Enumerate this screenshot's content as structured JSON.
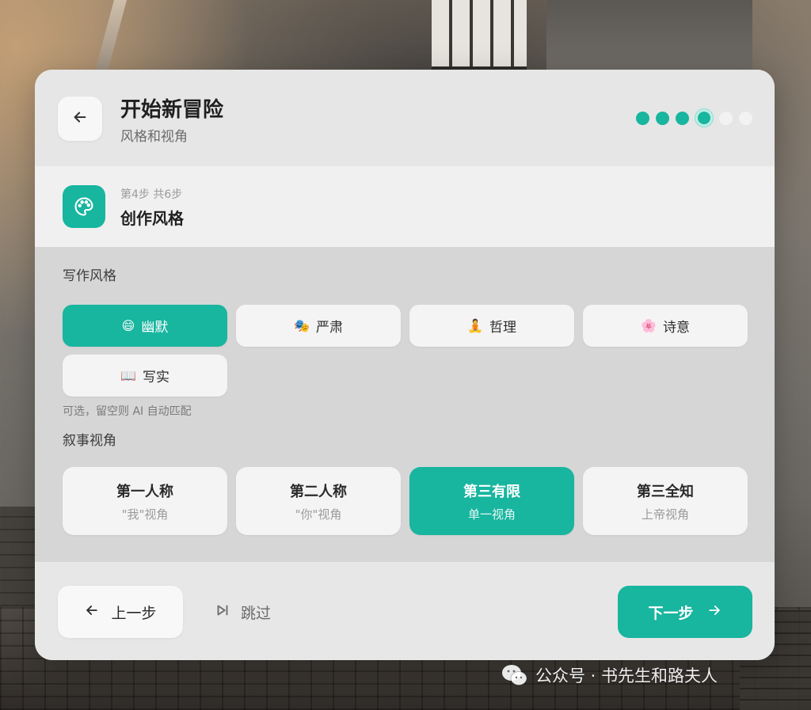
{
  "colors": {
    "accent": "#18b59f",
    "chip_bg": "#f4f4f4",
    "body_bg": "#d6d6d6"
  },
  "header": {
    "back_icon": "arrow-left-icon",
    "title": "开始新冒险",
    "subtitle": "风格和视角",
    "progress": {
      "total": 6,
      "current": 4
    }
  },
  "step": {
    "icon": "palette-icon",
    "count": "第4步 共6步",
    "name": "创作风格"
  },
  "writing_style": {
    "label": "写作风格",
    "options": [
      {
        "emoji": "😄",
        "label": "幽默",
        "selected": true
      },
      {
        "emoji": "🎭",
        "label": "严肃",
        "selected": false
      },
      {
        "emoji": "🧘",
        "label": "哲理",
        "selected": false
      },
      {
        "emoji": "🌸",
        "label": "诗意",
        "selected": false
      },
      {
        "emoji": "📖",
        "label": "写实",
        "selected": false
      }
    ],
    "hint": "可选，留空则 AI 自动匹配"
  },
  "perspective": {
    "label": "叙事视角",
    "options": [
      {
        "title": "第一人称",
        "desc": "\"我\"视角",
        "selected": false
      },
      {
        "title": "第二人称",
        "desc": "\"你\"视角",
        "selected": false
      },
      {
        "title": "第三有限",
        "desc": "单一视角",
        "selected": true
      },
      {
        "title": "第三全知",
        "desc": "上帝视角",
        "selected": false
      }
    ]
  },
  "footer": {
    "prev_label": "上一步",
    "skip_label": "跳过",
    "next_label": "下一步"
  },
  "watermark": {
    "text": "公众号 · 书先生和路夫人",
    "icon": "wechat-icon"
  }
}
